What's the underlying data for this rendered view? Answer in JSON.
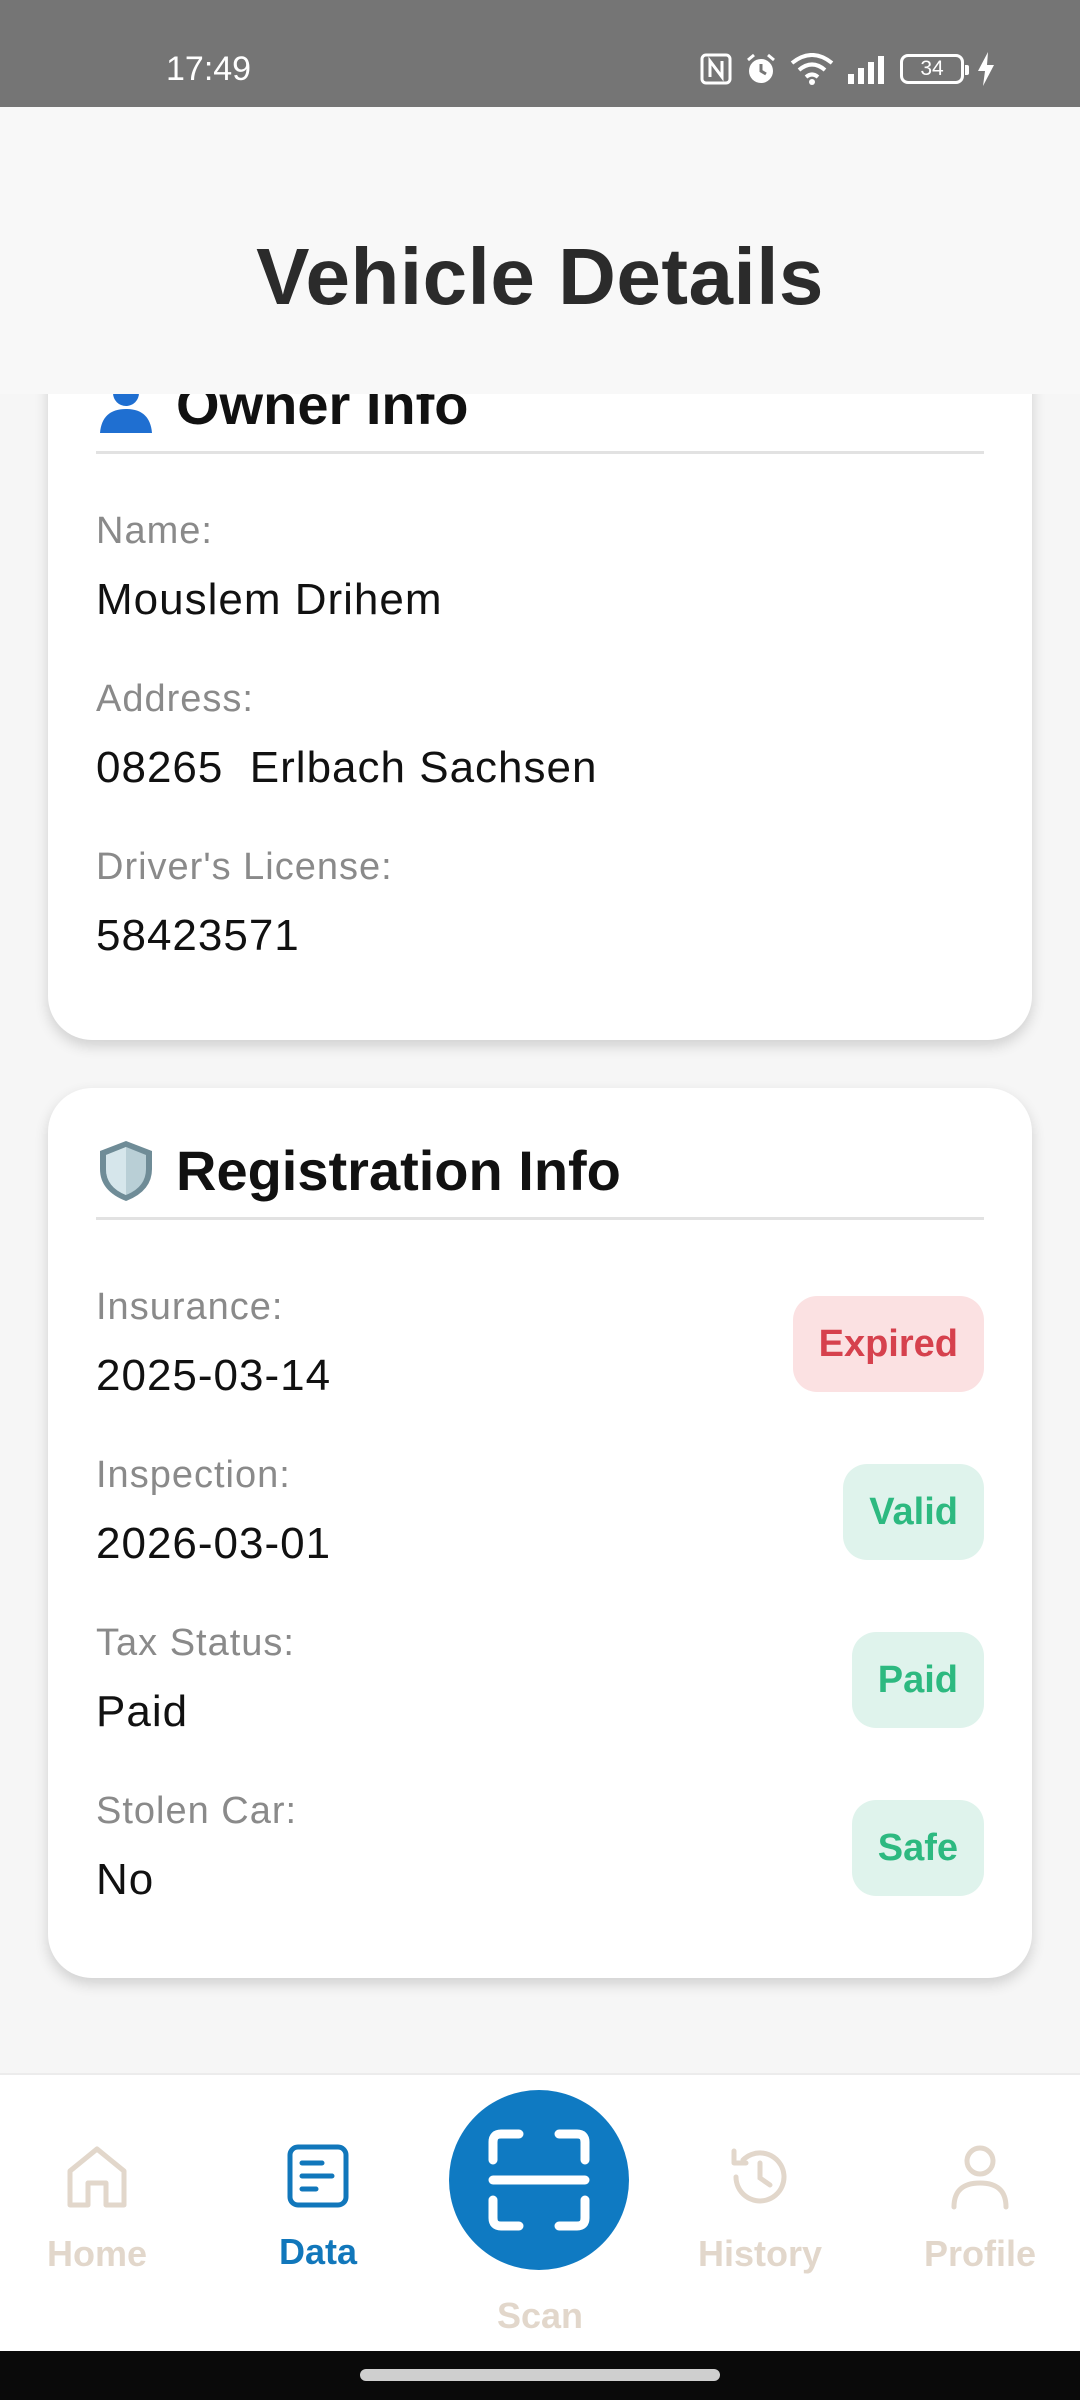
{
  "status_bar": {
    "time": "17:49",
    "battery": "34"
  },
  "header": {
    "title": "Vehicle Details"
  },
  "owner_card": {
    "title": "Owner Info",
    "icon": "person-icon",
    "fields": [
      {
        "label": "Name:",
        "value": "Mouslem Drihem"
      },
      {
        "label": "Address:",
        "value": "08265  Erlbach Sachsen"
      },
      {
        "label": "Driver's License:",
        "value": "58423571"
      }
    ]
  },
  "registration_card": {
    "title": "Registration Info",
    "icon": "shield-icon",
    "fields": [
      {
        "label": "Insurance:",
        "value": "2025-03-14",
        "badge": "Expired",
        "badge_color": "#d6414d"
      },
      {
        "label": "Inspection:",
        "value": "2026-03-01",
        "badge": "Valid",
        "badge_color": "#2db980"
      },
      {
        "label": "Tax Status:",
        "value": "Paid",
        "badge": "Paid",
        "badge_color": "#2db980"
      },
      {
        "label": "Stolen Car:",
        "value": "No",
        "badge": "Safe",
        "badge_color": "#2db980"
      }
    ]
  },
  "bottom_nav": {
    "items": [
      {
        "label": "Home",
        "icon": "home-icon"
      },
      {
        "label": "Data",
        "icon": "data-icon",
        "active": true
      },
      {
        "label": "Scan",
        "icon": "scan-icon"
      },
      {
        "label": "History",
        "icon": "history-icon"
      },
      {
        "label": "Profile",
        "icon": "profile-icon"
      }
    ],
    "active_color": "#1177bb",
    "inactive_color": "#e2d7cb",
    "fab_color": "#0f7ac2"
  }
}
